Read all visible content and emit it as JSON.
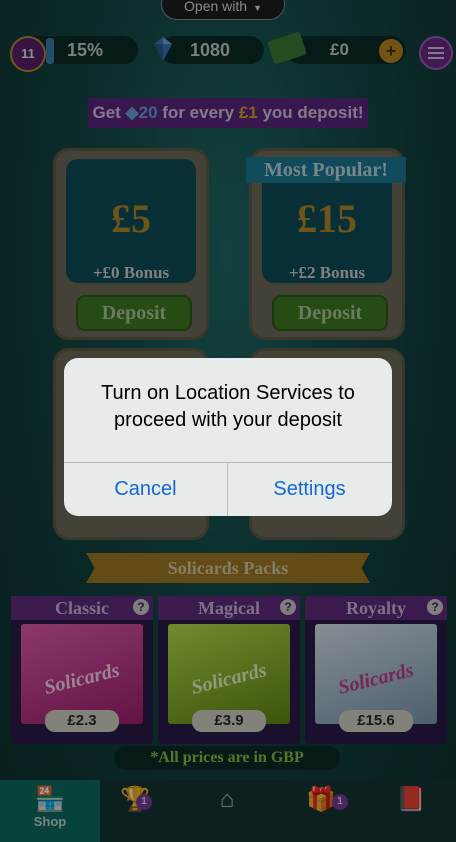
{
  "top": {
    "open_with_label": "Open with",
    "level": "11",
    "level_progress": "15%",
    "gems": "1080",
    "cash": "£0",
    "plus_label": "+"
  },
  "promo": {
    "text_before": "Get ",
    "gem_amount": "20",
    "text_middle": " for every ",
    "currency_amount": "£1",
    "text_after": " you deposit!"
  },
  "cards": [
    {
      "amount": "£5",
      "bonus": "+£0 Bonus",
      "button": "Deposit"
    },
    {
      "amount": "£15",
      "bonus": "+£2 Bonus",
      "button": "Deposit",
      "ribbon": "Most Popular!"
    }
  ],
  "packs_title": "Solicards Packs",
  "packs": [
    {
      "title": "Classic",
      "price": "£2.3",
      "color": "#d43f9a",
      "art_label": "Solicards"
    },
    {
      "title": "Magical",
      "price": "£3.9",
      "color": "#8fbf2a",
      "art_label": "Solicards"
    },
    {
      "title": "Royalty",
      "price": "£15.6",
      "color": "#9fb8c6",
      "art_label": "Solicards"
    }
  ],
  "help_label": "?",
  "gbp_note": "*All prices are in GBP",
  "nav": {
    "shop_label": "Shop",
    "trophy_badge": "1",
    "gift_badge": "1"
  },
  "alert": {
    "message": "Turn on Location Services to proceed with your deposit",
    "cancel": "Cancel",
    "settings": "Settings"
  }
}
